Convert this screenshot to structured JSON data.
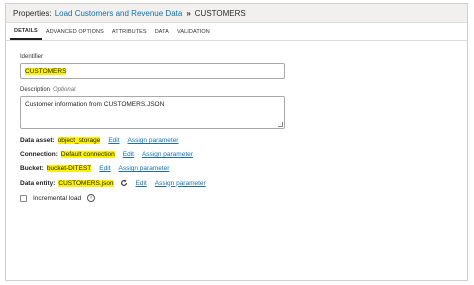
{
  "header": {
    "prefix": "Properties:",
    "link": "Load Customers and Revenue Data",
    "separator": "»",
    "current": "CUSTOMERS"
  },
  "tabs": [
    {
      "label": "DETAILS",
      "active": true
    },
    {
      "label": "ADVANCED OPTIONS",
      "active": false
    },
    {
      "label": "ATTRIBUTES",
      "active": false
    },
    {
      "label": "DATA",
      "active": false
    },
    {
      "label": "VALIDATION",
      "active": false
    }
  ],
  "identifier": {
    "label": "Identifier",
    "value": "CUSTOMERS"
  },
  "description": {
    "label": "Description",
    "optional": "Optional",
    "value": "Customer information from CUSTOMERS.JSON"
  },
  "properties": {
    "data_asset": {
      "label": "Data asset:",
      "value": "object_storage",
      "edit": "Edit",
      "assign": "Assign parameter"
    },
    "connection": {
      "label": "Connection:",
      "value": "Default connection",
      "edit": "Edit",
      "assign": "Assign parameter"
    },
    "bucket": {
      "label": "Bucket:",
      "value": "bucket-DITEST",
      "edit": "Edit",
      "assign": "Assign parameter"
    },
    "data_entity": {
      "label": "Data entity:",
      "value": "CUSTOMERS.json",
      "edit": "Edit",
      "assign": "Assign parameter"
    }
  },
  "incremental_load": {
    "label": "Incremental load",
    "checked": false,
    "info_icon": "i"
  }
}
